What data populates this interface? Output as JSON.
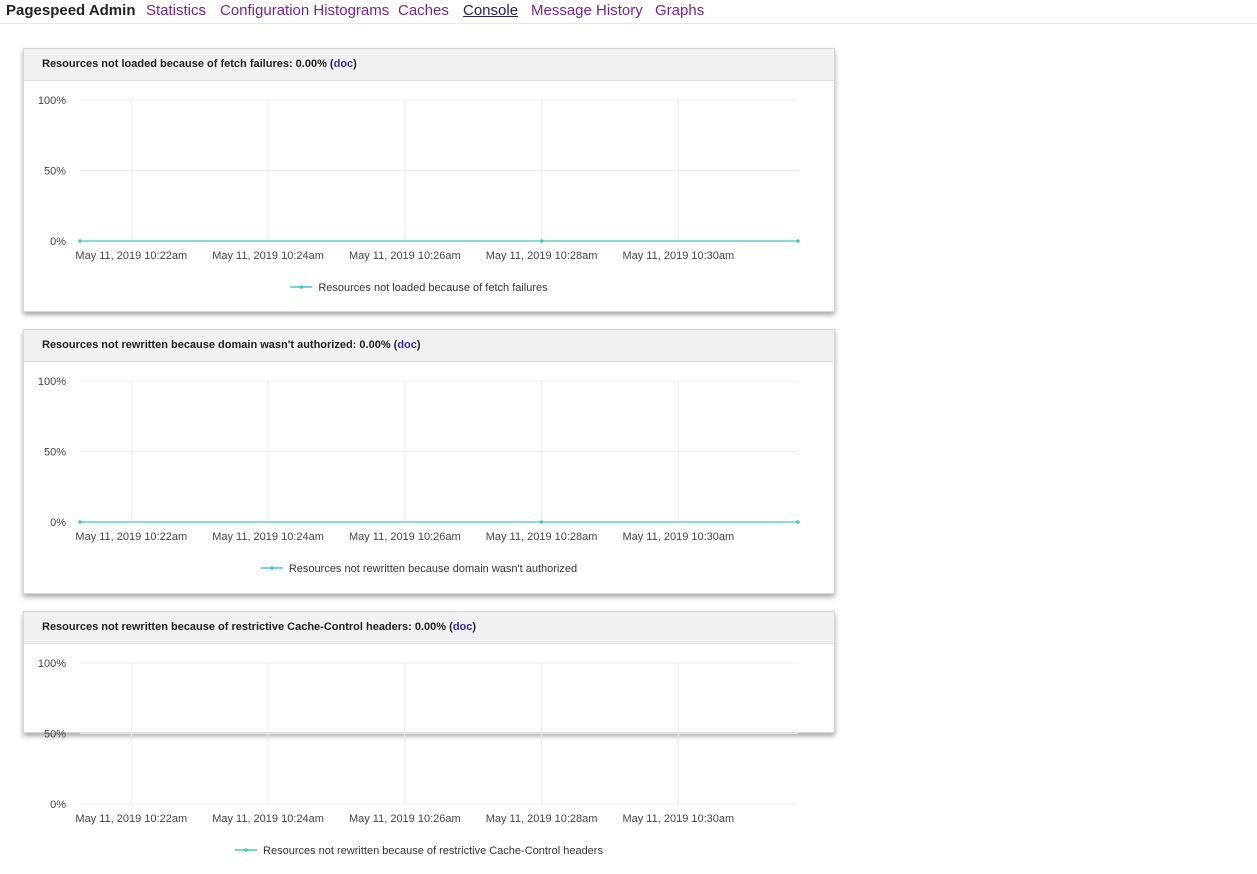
{
  "nav": {
    "brand": "Pagespeed Admin",
    "links": [
      "Statistics",
      "Configuration Histograms",
      "Caches",
      "Console",
      "Message History",
      "Graphs"
    ]
  },
  "charts": [
    {
      "title_prefix": "Resources not loaded because of fetch failures: 0.00% (",
      "doc_link": "doc",
      "title_suffix": ")",
      "legend": "Resources not loaded because of fetch failures"
    },
    {
      "title_prefix": "Resources not rewritten because domain wasn't authorized: 0.00% (",
      "doc_link": "doc",
      "title_suffix": ")",
      "legend": "Resources not rewritten because domain wasn't authorized"
    },
    {
      "title_prefix": "Resources not rewritten because of restrictive Cache-Control headers: 0.00% (",
      "doc_link": "doc",
      "title_suffix": ")",
      "legend": "Resources not rewritten because of restrictive Cache-Control headers"
    }
  ],
  "chart_data": [
    {
      "type": "line",
      "x": [
        "May 11, 2019 10:21:15am",
        "May 11, 2019 10:28am",
        "May 11, 2019 10:31:45am"
      ],
      "x_ticks": [
        "May 11, 2019 10:22am",
        "May 11, 2019 10:24am",
        "May 11, 2019 10:26am",
        "May 11, 2019 10:28am",
        "May 11, 2019 10:30am"
      ],
      "y_ticks": [
        "100%",
        "50%",
        "0%"
      ],
      "ylim": [
        0,
        100
      ],
      "series": [
        {
          "name": "Resources not loaded because of fetch failures",
          "values": [
            0,
            0,
            0
          ]
        }
      ],
      "grid": true,
      "legend_position": "bottom",
      "color": "#3cc9c4"
    },
    {
      "type": "line",
      "x": [
        "May 11, 2019 10:21:15am",
        "May 11, 2019 10:28am",
        "May 11, 2019 10:31:45am"
      ],
      "x_ticks": [
        "May 11, 2019 10:22am",
        "May 11, 2019 10:24am",
        "May 11, 2019 10:26am",
        "May 11, 2019 10:28am",
        "May 11, 2019 10:30am"
      ],
      "y_ticks": [
        "100%",
        "50%",
        "0%"
      ],
      "ylim": [
        0,
        100
      ],
      "series": [
        {
          "name": "Resources not rewritten because domain wasn't authorized",
          "values": [
            0,
            0,
            0
          ]
        }
      ],
      "grid": true,
      "legend_position": "bottom",
      "color": "#3cc9c4"
    },
    {
      "type": "line",
      "x": [],
      "x_ticks": [
        "May 11, 2019 10:22am",
        "May 11, 2019 10:24am",
        "May 11, 2019 10:26am",
        "May 11, 2019 10:28am",
        "May 11, 2019 10:30am"
      ],
      "y_ticks": [
        "100%",
        "50%",
        "0%"
      ],
      "ylim": [
        0,
        100
      ],
      "series": [
        {
          "name": "Resources not rewritten because of restrictive Cache-Control headers",
          "values": []
        }
      ],
      "grid": true,
      "legend_position": "bottom",
      "color": "#3cc9c4"
    }
  ]
}
